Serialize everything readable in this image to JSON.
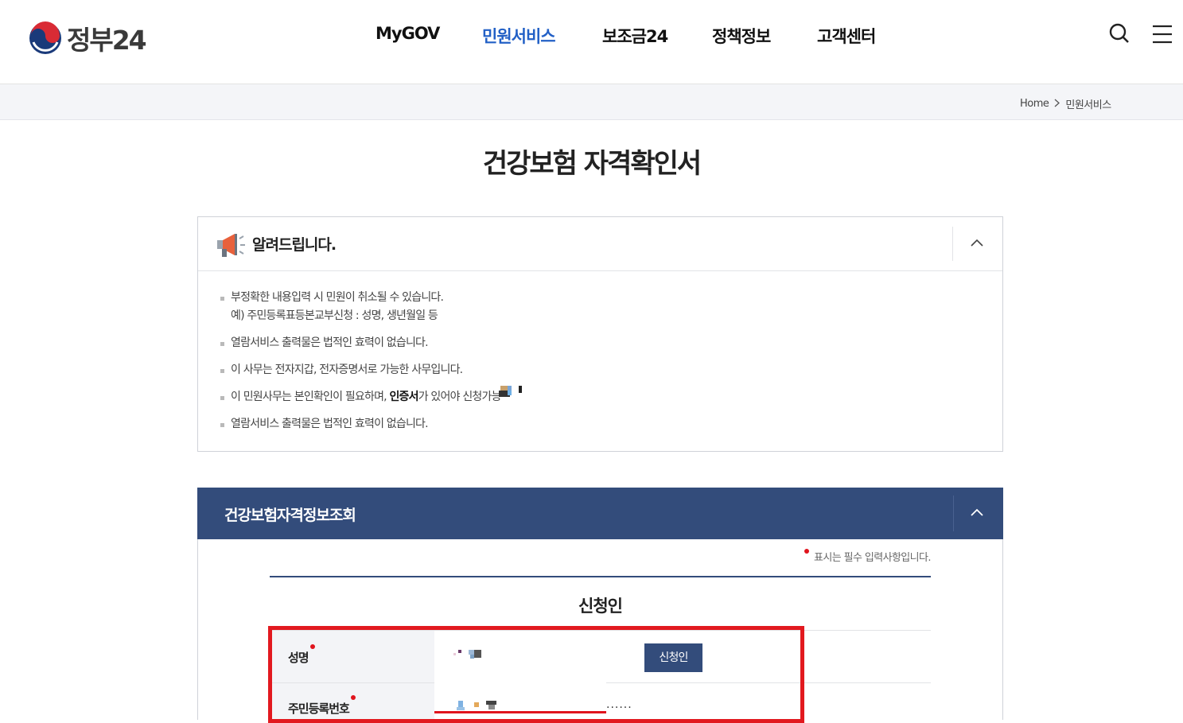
{
  "header": {
    "logo_text": "정부24",
    "nav": [
      {
        "label": "MyGOV",
        "active": false
      },
      {
        "label": "민원서비스",
        "active": true
      },
      {
        "label": "보조금24",
        "active": false
      },
      {
        "label": "정책정보",
        "active": false
      },
      {
        "label": "고객센터",
        "active": false
      }
    ],
    "search_icon": "search-icon",
    "menu_icon": "hamburger-menu-icon",
    "active_color": "#2260c6"
  },
  "breadcrumb": {
    "home": "Home",
    "current": "민원서비스"
  },
  "page_title": "건강보험 자격확인서",
  "notice": {
    "title": "알려드립니다.",
    "icon": "megaphone-icon",
    "items": [
      {
        "line1": "부정확한 내용입력 시 민원이 취소될 수 있습니다.",
        "line2": "예) 주민등록표등본교부신청 : 성명, 생년월일 등"
      },
      {
        "line1": "열람서비스 출력물은 법적인 효력이 없습니다."
      },
      {
        "line1": "이 사무는 전자지갑, 전자증명서로 가능한 사무입니다."
      },
      {
        "prefix": "이 민원사무는 본인확인이 필요하며, ",
        "bold": "인증서",
        "suffix": "가 있어야 신청가능합"
      },
      {
        "line1": "열람서비스 출력물은 법적인 효력이 없습니다."
      }
    ]
  },
  "section": {
    "title": "건강보험자격정보조회",
    "bar_color": "#334c7b",
    "required_note": "표시는 필수 입력사항입니다.",
    "form_title": "신청인",
    "fields": {
      "name_label": "성명",
      "applicant_button": "신청인",
      "id_label": "주민등록번호",
      "id_masked": "······"
    }
  },
  "colors": {
    "highlight_border": "#e2191f",
    "required_dot": "#e0141d"
  }
}
